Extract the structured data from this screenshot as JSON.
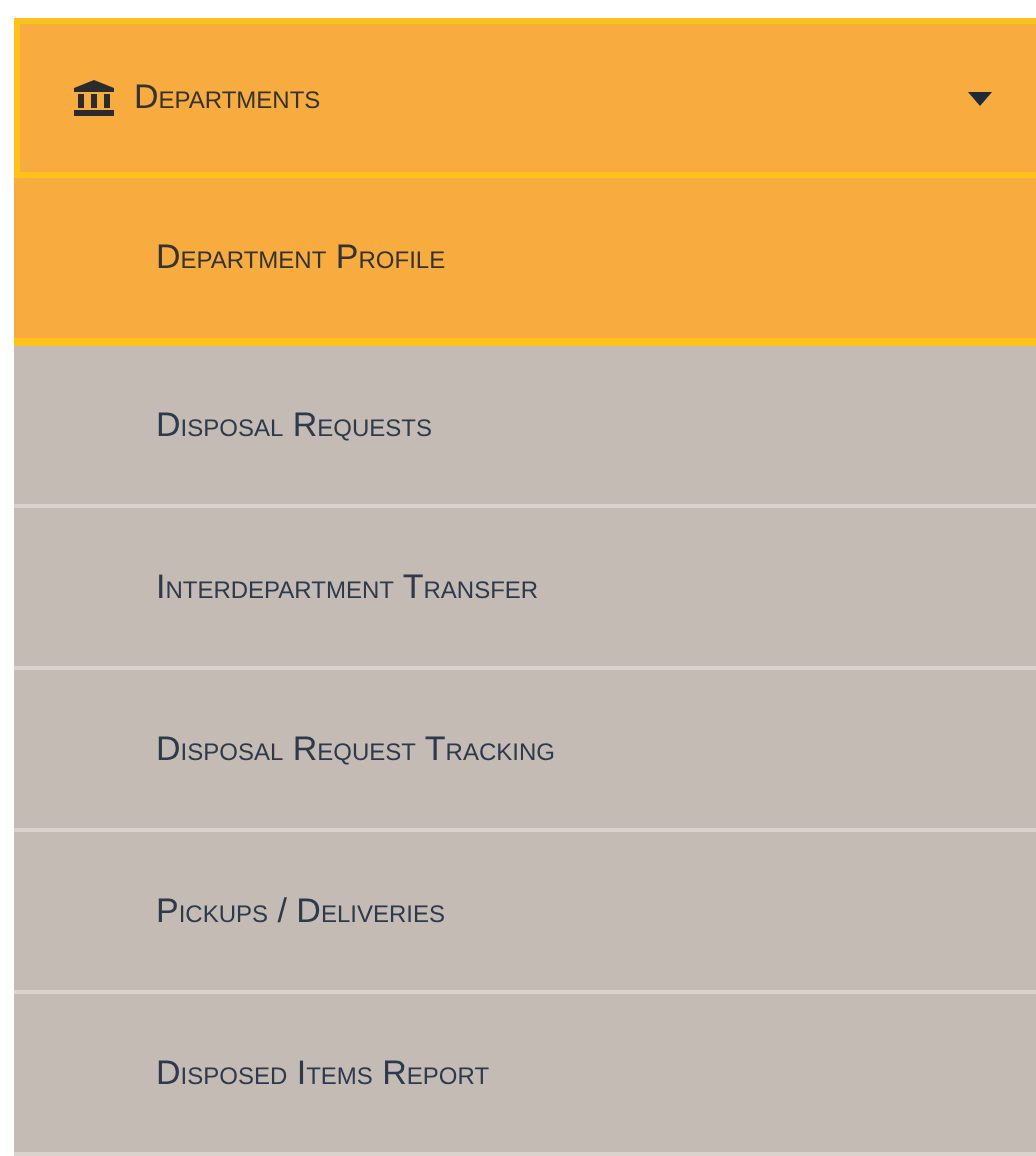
{
  "menu": {
    "title": "Departments",
    "expanded": true,
    "items": [
      {
        "label": "Department Profile",
        "selected": true
      },
      {
        "label": "Disposal Requests",
        "selected": false
      },
      {
        "label": "Interdepartment Transfer",
        "selected": false
      },
      {
        "label": "Disposal Request Tracking",
        "selected": false
      },
      {
        "label": "Pickups / Deliveries",
        "selected": false
      },
      {
        "label": "Disposed Items Report",
        "selected": false
      }
    ]
  }
}
